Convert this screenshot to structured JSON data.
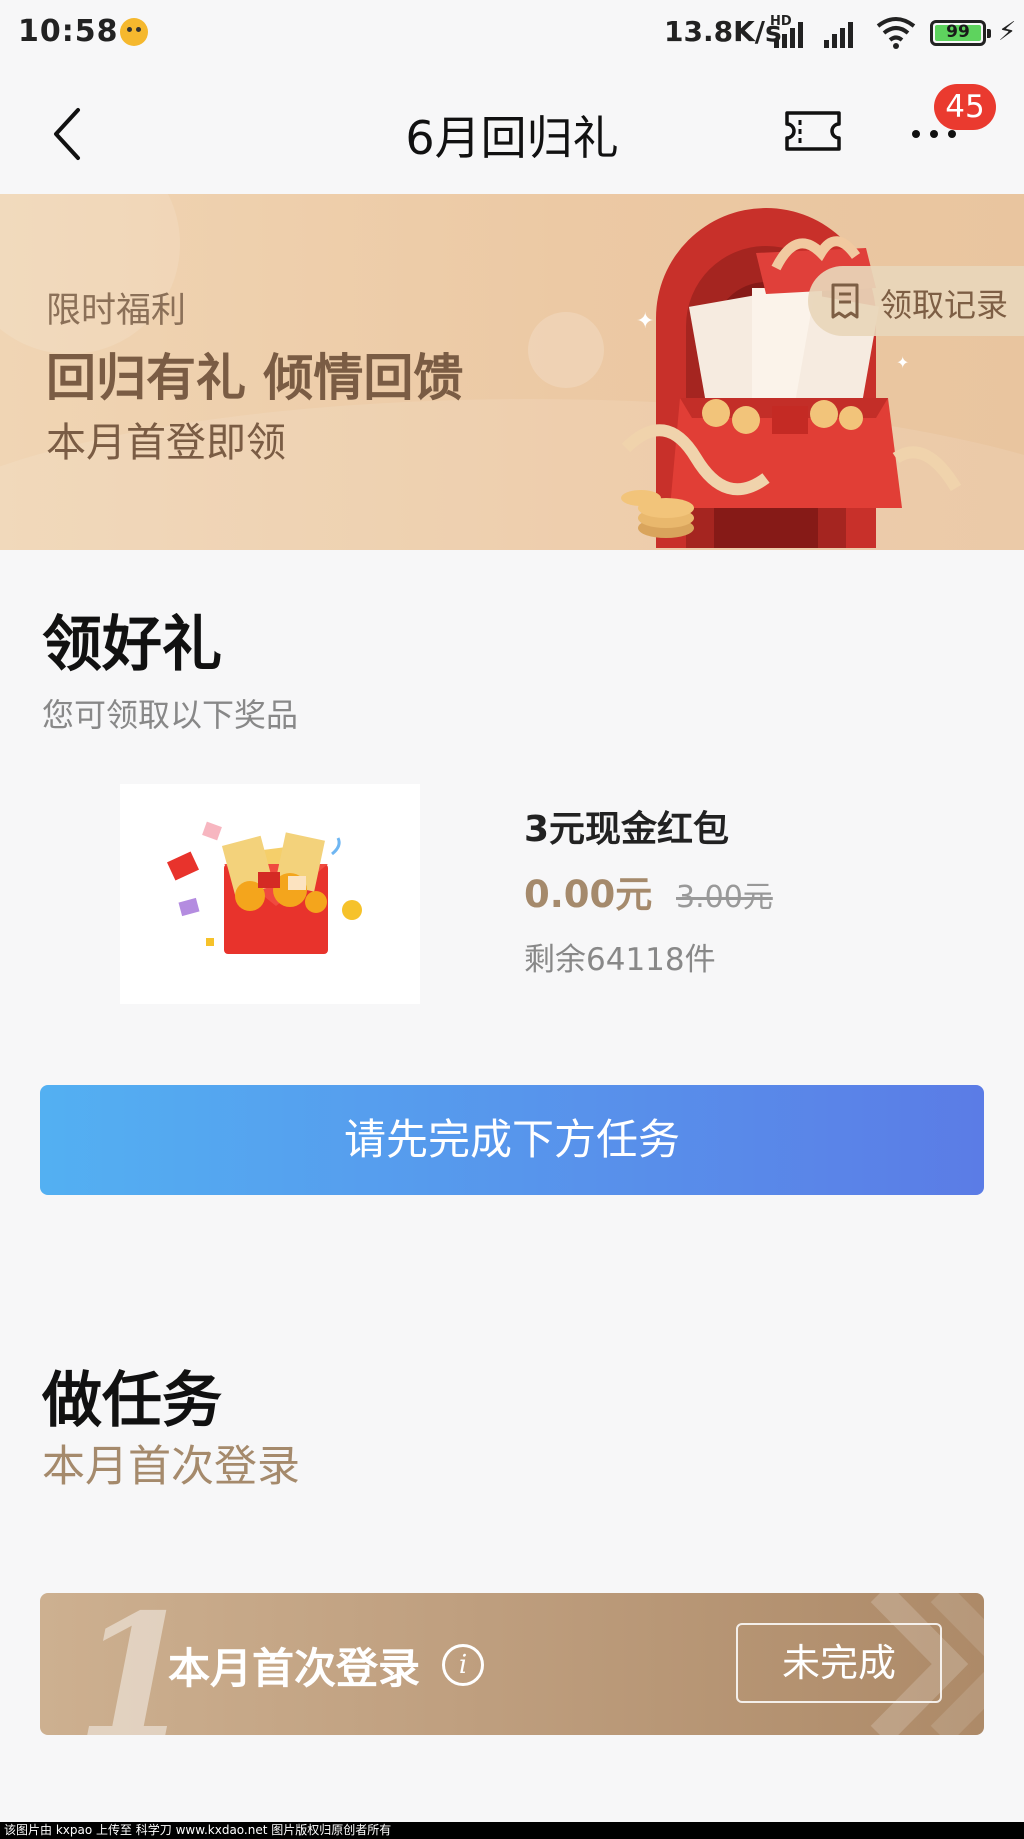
{
  "status_bar": {
    "time": "10:58",
    "net_speed": "13.8K/s",
    "hd_label": "HD",
    "battery": "99"
  },
  "nav": {
    "title": "6月回归礼",
    "badge_count": "45"
  },
  "banner": {
    "tag": "限时福利",
    "title": "回归有礼 倾情回馈",
    "subtitle": "本月首登即领",
    "records_label": "领取记录"
  },
  "gift_section": {
    "title": "领好礼",
    "subtitle": "您可领取以下奖品",
    "item": {
      "name": "3元现金红包",
      "price": "0.00元",
      "original_price": "3.00元",
      "stock": "剩余64118件"
    },
    "cta_label": "请先完成下方任务"
  },
  "task_section": {
    "title": "做任务",
    "subtitle": "本月首次登录",
    "tasks": [
      {
        "index": "1",
        "label": "本月首次登录",
        "info_glyph": "i",
        "status": "未完成"
      }
    ]
  },
  "footer": {
    "watermark": "该图片由 kxpao 上传至 科学刀 www.kxdao.net 图片版权归原创者所有"
  },
  "colors": {
    "accent_gold": "#a58a6c",
    "badge_red": "#ea3a2f",
    "cta_start": "#53b0f2",
    "cta_end": "#5b7ce6"
  }
}
